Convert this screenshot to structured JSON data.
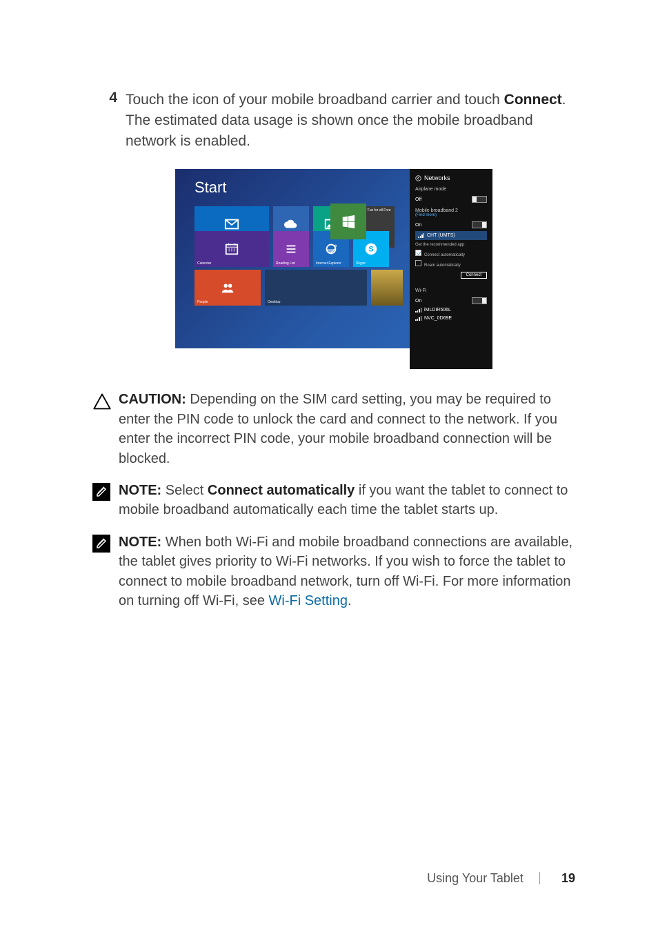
{
  "step": {
    "number": "4",
    "text_pre": "Touch the icon of your mobile broadband carrier and touch ",
    "bold": "Connect",
    "text_post": ". The estimated data usage is shown once the mobile broadband network is enabled."
  },
  "screenshot": {
    "start_label": "Start",
    "tiles": {
      "mail": "Mail",
      "skydrive": "SkyDrive",
      "photos": "Photos",
      "store": "",
      "star_wars": "Star W\nFun for all\nFree ★★★",
      "calendar": "Calendar",
      "reading_list": "Reading List",
      "ie": "Internet Explorer",
      "skype": "Skype",
      "people": "People",
      "desktop": "Desktop"
    },
    "sidepanel": {
      "title": "Networks",
      "airplane": {
        "label": "Airplane mode",
        "state": "Off"
      },
      "mbb": {
        "label": "Mobile broadband 2",
        "find_more": "(Find more)",
        "state": "On",
        "selected": "CHT (UMTS)",
        "recommend": "Get the recommended app",
        "opt_connect": "Connect automatically",
        "opt_roam": "Roam automatically",
        "connect_btn": "Connect"
      },
      "wifi": {
        "label": "Wi-Fi",
        "state": "On",
        "nets": [
          "iMLDIR506L",
          "NVC_0D69E"
        ]
      }
    }
  },
  "caution": {
    "label": "CAUTION:",
    "text": " Depending on the SIM card setting, you may be required to enter the PIN code to unlock the card and connect to the network. If you enter the incorrect PIN code, your mobile broadband connection will be blocked."
  },
  "note1": {
    "label": "NOTE:",
    "text_pre": " Select ",
    "bold": "Connect automatically",
    "text_post": " if you want the tablet to connect to mobile broadband automatically each time the tablet starts up."
  },
  "note2": {
    "label": "NOTE:",
    "text_pre": " When both Wi-Fi and mobile broadband connections are available, the tablet gives priority to Wi-Fi networks. If you wish to force the tablet to connect to mobile broadband network, turn off Wi-Fi. For more information on turning off Wi-Fi, see ",
    "link": "Wi-Fi Setting",
    "text_post": "."
  },
  "footer": {
    "section": "Using Your Tablet",
    "page": "19"
  }
}
